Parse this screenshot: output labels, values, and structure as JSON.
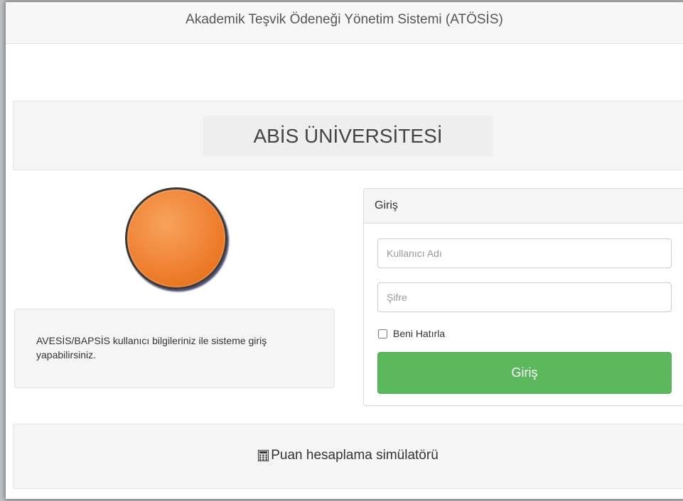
{
  "header": {
    "title": "Akademik Teşvik Ödeneği Yönetim Sistemi (ATÖSİS)"
  },
  "institution": {
    "name": "ABİS ÜNİVERSİTESİ"
  },
  "info": {
    "text": "AVESİS/BAPSİS kullanıcı bilgileriniz ile sisteme giriş yapabilirsiniz."
  },
  "login": {
    "heading": "Giriş",
    "username_placeholder": "Kullanıcı Adı",
    "username_value": "",
    "password_placeholder": "Şifre",
    "password_value": "",
    "remember_label": "Beni Hatırla",
    "remember_checked": false,
    "submit_label": "Giriş"
  },
  "simulator": {
    "icon": "calculator-icon",
    "label": "Puan hesaplama simülatörü"
  },
  "colors": {
    "accent_green": "#5cb85c",
    "logo_orange": "#f1873a",
    "panel_bg": "#f5f5f5"
  }
}
